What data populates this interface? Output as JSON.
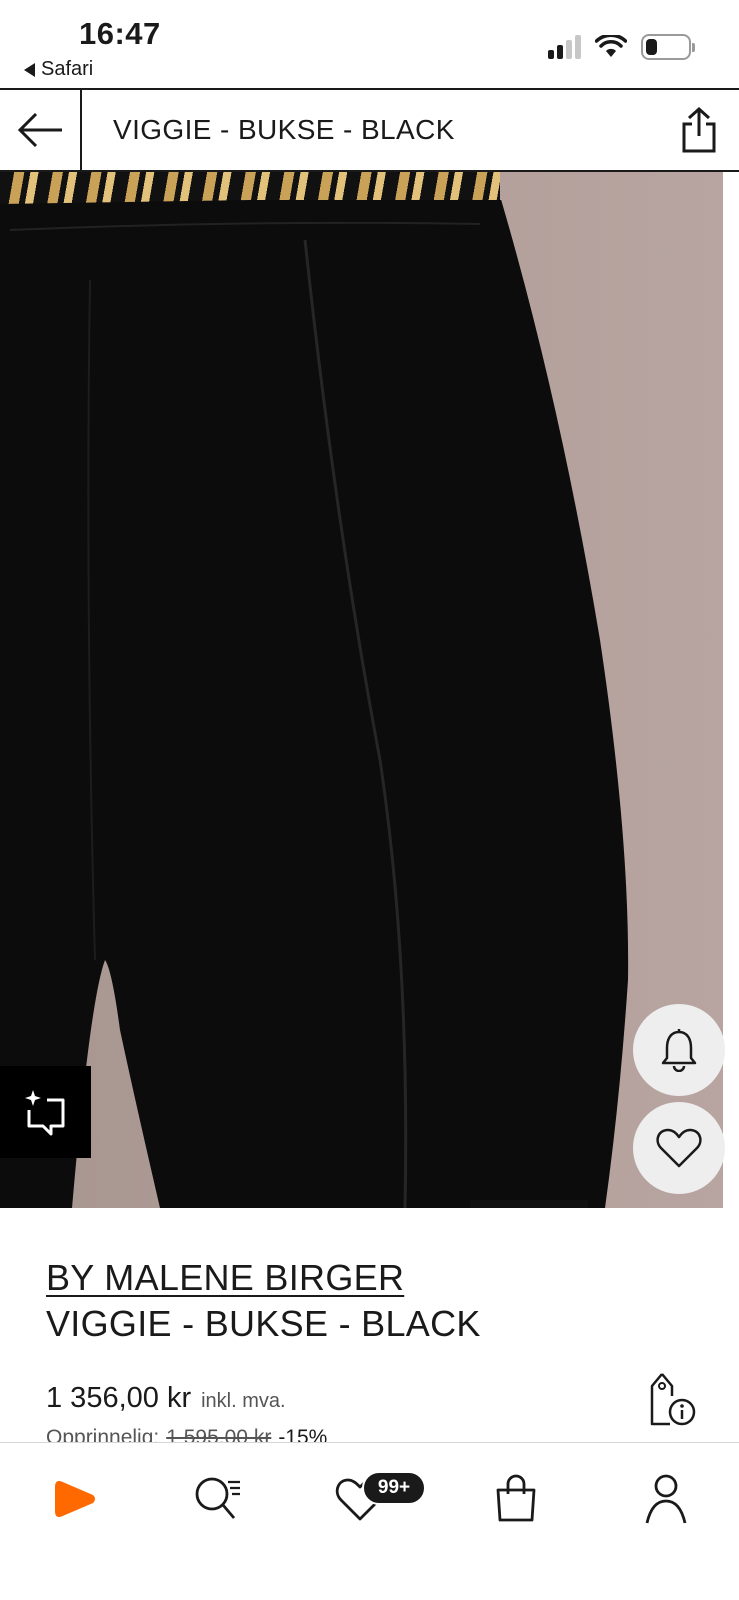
{
  "status_bar": {
    "time": "16:47",
    "back_app_label": "Safari",
    "icons": [
      "signal-icon",
      "wifi-icon",
      "battery-icon"
    ]
  },
  "header": {
    "title": "VIGGIE - BUKSE - BLACK",
    "back_icon": "arrow-left-icon",
    "share_icon": "share-icon"
  },
  "product": {
    "brand": "BY MALENE BIRGER",
    "name": "VIGGIE - BUKSE - BLACK",
    "price": "1 356,00 kr",
    "vat_note": "inkl. mva.",
    "original_label": "Opprinnelig:",
    "original_price": "1 595,00 kr",
    "discount": "-15%"
  },
  "image_actions": {
    "ai_icon": "sparkle-chat-icon",
    "bell_icon": "bell-icon",
    "heart_icon": "heart-icon"
  },
  "bottom_nav": {
    "items": [
      "home-logo",
      "search-icon",
      "wishlist-icon",
      "bag-icon",
      "profile-icon"
    ],
    "wishlist_badge": "99+"
  },
  "colors": {
    "brand_orange": "#ff6900",
    "text": "#1a1a1a",
    "image_background": "#b19e99"
  }
}
